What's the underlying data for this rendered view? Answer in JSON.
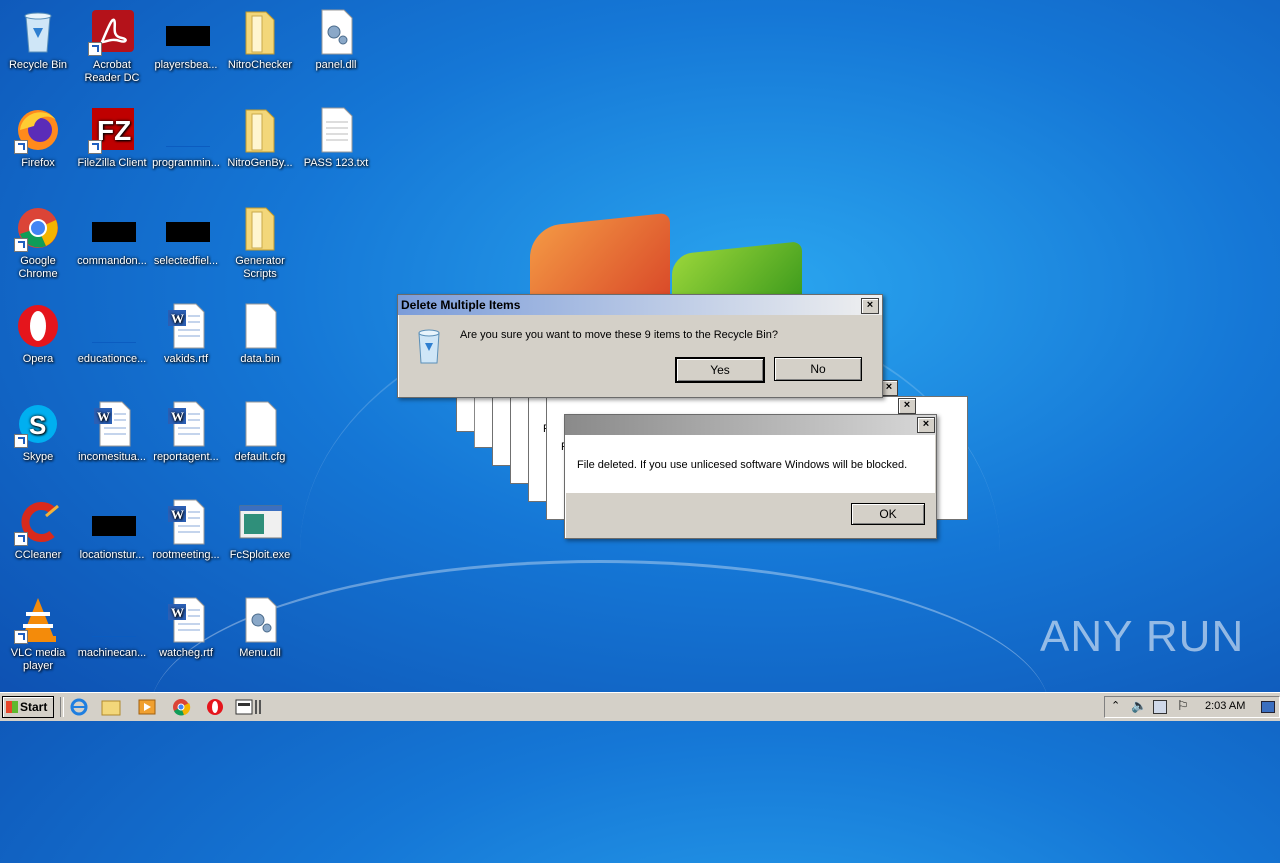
{
  "desktop_icons": [
    {
      "label": "Recycle Bin",
      "icon": "recycle-bin-icon"
    },
    {
      "label": "Acrobat Reader DC",
      "icon": "acrobat-icon"
    },
    {
      "label": "playersbea...",
      "icon": "redacted-icon"
    },
    {
      "label": "NitroChecker",
      "icon": "folder-icon"
    },
    {
      "label": "panel.dll",
      "icon": "dll-file-icon"
    },
    {
      "label": "Firefox",
      "icon": "firefox-icon"
    },
    {
      "label": "FileZilla Client",
      "icon": "filezilla-icon"
    },
    {
      "label": "programmin...",
      "icon": "blank-icon"
    },
    {
      "label": "NitroGenBy...",
      "icon": "folder-icon"
    },
    {
      "label": "PASS 123.txt",
      "icon": "text-file-icon"
    },
    {
      "label": "Google Chrome",
      "icon": "chrome-icon"
    },
    {
      "label": "commandon...",
      "icon": "redacted-icon"
    },
    {
      "label": "selectedfiel...",
      "icon": "redacted-icon"
    },
    {
      "label": "Generator Scripts",
      "icon": "folder-icon"
    },
    {
      "label": "Opera",
      "icon": "opera-icon"
    },
    {
      "label": "educationce...",
      "icon": "blank-icon"
    },
    {
      "label": "vakids.rtf",
      "icon": "word-doc-icon"
    },
    {
      "label": "data.bin",
      "icon": "blank-file-icon"
    },
    {
      "label": "Skype",
      "icon": "skype-icon"
    },
    {
      "label": "incomesitua...",
      "icon": "word-doc-icon"
    },
    {
      "label": "reportagent...",
      "icon": "word-doc-icon"
    },
    {
      "label": "default.cfg",
      "icon": "blank-file-icon"
    },
    {
      "label": "CCleaner",
      "icon": "ccleaner-icon"
    },
    {
      "label": "locationstur...",
      "icon": "redacted-icon"
    },
    {
      "label": "rootmeeting...",
      "icon": "word-doc-icon"
    },
    {
      "label": "FcSploit.exe",
      "icon": "exe-window-icon"
    },
    {
      "label": "VLC media player",
      "icon": "vlc-icon"
    },
    {
      "label": "machinecan...",
      "icon": "blank-icon"
    },
    {
      "label": "watcheg.rtf",
      "icon": "word-doc-icon"
    },
    {
      "label": "Menu.dll",
      "icon": "dll-file-icon"
    }
  ],
  "delete_dialog": {
    "title": "Delete Multiple Items",
    "message": "Are you sure you want to move these 9 items to the Recycle Bin?",
    "yes_label": "Yes",
    "no_label": "No",
    "close_label": "×"
  },
  "ghost_letters": [
    "F",
    "F",
    "F",
    "F"
  ],
  "file_deleted_dialog": {
    "message": "File deleted. If you use unlicesed software Windows will be blocked.",
    "ok_label": "OK",
    "close_label": "×"
  },
  "taskbar": {
    "start_label": "Start",
    "clock": "2:03 AM"
  },
  "watermark": "ANY RUN"
}
